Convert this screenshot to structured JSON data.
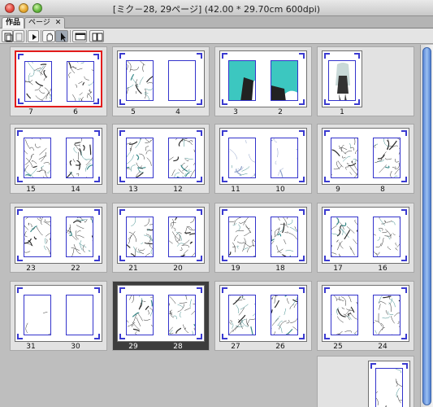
{
  "window": {
    "title": "[ミク－28, 29ページ] (42.00 * 29.70cm 600dpi)"
  },
  "tabs": [
    {
      "label": "作品",
      "active": true
    },
    {
      "label": "ページ",
      "active": false,
      "close": "✕"
    }
  ],
  "toolbar": {
    "buttons": [
      "page-icon",
      "copy-page-icon",
      "play-icon",
      "hand-icon",
      "pointer-icon",
      "single-view-icon",
      "spread-view-icon"
    ],
    "selected": "pointer-icon"
  },
  "spreads": [
    {
      "left": "7",
      "right": "6",
      "style": "red",
      "art": "sketch"
    },
    {
      "left": "5",
      "right": "4",
      "style": "normal",
      "art": "half"
    },
    {
      "left": "3",
      "right": "2",
      "style": "normal",
      "art": "color"
    },
    {
      "left": "",
      "right": "1",
      "style": "single",
      "art": "figure"
    },
    {
      "left": "15",
      "right": "14",
      "style": "normal",
      "art": "sketch"
    },
    {
      "left": "13",
      "right": "12",
      "style": "normal",
      "art": "sketch"
    },
    {
      "left": "11",
      "right": "10",
      "style": "normal",
      "art": "light"
    },
    {
      "left": "9",
      "right": "8",
      "style": "normal",
      "art": "sketch"
    },
    {
      "left": "23",
      "right": "22",
      "style": "normal",
      "art": "sketch"
    },
    {
      "left": "21",
      "right": "20",
      "style": "normal",
      "art": "sketch"
    },
    {
      "left": "19",
      "right": "18",
      "style": "normal",
      "art": "sketch"
    },
    {
      "left": "17",
      "right": "16",
      "style": "normal",
      "art": "sketch"
    },
    {
      "left": "31",
      "right": "30",
      "style": "normal",
      "art": "blank"
    },
    {
      "left": "29",
      "right": "28",
      "style": "dark",
      "art": "sketch"
    },
    {
      "left": "27",
      "right": "26",
      "style": "normal",
      "art": "sketch"
    },
    {
      "left": "25",
      "right": "24",
      "style": "normal",
      "art": "sketch"
    }
  ],
  "colors": {
    "selection_border": "#e21b1b",
    "page_frame": "#3333cc",
    "selected_spread_bg": "#3d3d3d",
    "scroll_thumb": "#7aa6ea"
  }
}
